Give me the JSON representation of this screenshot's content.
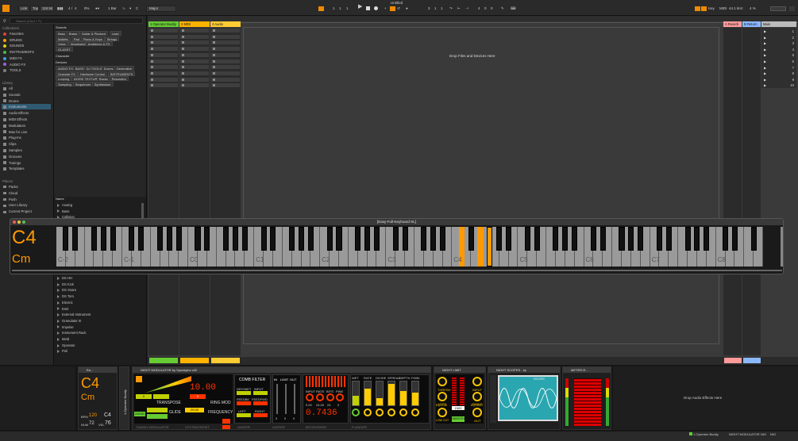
{
  "topbar": {
    "link": "Link",
    "tap": "Tap",
    "tempo": "119.94",
    "time_sig_num": "4",
    "time_sig_den": "4",
    "percent": "0%",
    "quantize": "1 Bar",
    "key": "C",
    "scale": "Major",
    "pos1": "1",
    "pos2": "1",
    "pos3": "1",
    "loop1": "3",
    "loop2": "1",
    "loop3": "1",
    "len1": "4",
    "len2": "0",
    "len3": "0",
    "window_title": "Untitled",
    "key_label": "Key",
    "midi_label": "MIDI",
    "sample_rate": "44.1 kHz",
    "cpu": "4 %"
  },
  "browser": {
    "search_placeholder": "Search (Cmd + F)",
    "collections_head": "Collections",
    "collections": [
      {
        "label": "Favorites",
        "color": "#e04040"
      },
      {
        "label": "DRUMS",
        "color": "#f0a000"
      },
      {
        "label": "SOUNDS",
        "color": "#e0d000"
      },
      {
        "label": "INSTRUMENTS",
        "color": "#40c040"
      },
      {
        "label": "MIDI FX",
        "color": "#40a0e0"
      },
      {
        "label": "AUDIO FX",
        "color": "#a060e0"
      },
      {
        "label": "TOOLS",
        "color": "#808080"
      }
    ],
    "library_head": "Library",
    "library": [
      "All",
      "Sounds",
      "Drums",
      "Instruments",
      "Audio Effects",
      "MIDI Effects",
      "Modulators",
      "Max for Live",
      "Plug-Ins",
      "Clips",
      "Samples",
      "Grooves",
      "Tunings",
      "Templates"
    ],
    "places_head": "Places",
    "places": [
      "Packs",
      "Cloud",
      "Push",
      "User Library",
      "Current Project"
    ],
    "sounds_label": "Sounds",
    "sound_tags": [
      [
        "Bass",
        "Brass",
        "Guitar & Plucked",
        "Lead"
      ],
      [
        "Mallets",
        "Pad",
        "Piano & Keys",
        "Strings"
      ],
      [
        "Voice",
        "Woodwind",
        "Ambience & FX"
      ],
      [
        "GLASST"
      ]
    ],
    "character_label": "Character",
    "devices_label": "Devices",
    "device_tags": [
      [
        "AUDIO FX",
        "BASS",
        "DJ TOOLS",
        "Drums",
        "Generative"
      ],
      [
        "Granular FX",
        "Hardware Control",
        "INSTRUMENTS"
      ],
      [
        "Looping",
        "NOISE TEXTURE",
        "Racks",
        "Resonator"
      ],
      [
        "Sampling",
        "Sequencer",
        "Synthesizer"
      ]
    ],
    "name_head": "Name",
    "names_top": [
      "Analog",
      "Bass",
      "Collision"
    ],
    "names_bottom": [
      "DS HH",
      "DS Kick",
      "DS Snare",
      "DS Tom",
      "Electric",
      "Emit",
      "External Instrument",
      "Granulator III",
      "Impulse",
      "Instrument Rack",
      "Meld",
      "Operator",
      "Poli"
    ]
  },
  "session": {
    "tracks": [
      {
        "label": "1 Operator Buddy",
        "color": "#66cc33"
      },
      {
        "label": "2 MIDI",
        "color": "#ffb300"
      },
      {
        "label": "3 Audio",
        "color": "#ffcc33"
      }
    ],
    "drop_text": "Drop Files and Devices Here",
    "returns": [
      {
        "label": "A Reverb",
        "color": "#ff9a9a"
      },
      {
        "label": "B Return",
        "color": "#8ab8ff"
      }
    ],
    "main_label": "Main",
    "scene_numbers": [
      "1",
      "2",
      "3",
      "4",
      "5",
      "6",
      "7",
      "8",
      "9",
      "10"
    ]
  },
  "keyboard": {
    "title": "[Easy-Full-Keyboard-XL]",
    "note": "C4",
    "chord": "Cm",
    "octave_labels": [
      "C-2",
      "C-1",
      "C0",
      "C1",
      "C2",
      "C3",
      "C4",
      "C5",
      "C6",
      "C7",
      "C8"
    ],
    "highlight_color": "#ff9900"
  },
  "devices": {
    "dev1_title": "Ea...",
    "dev1_note": "C4",
    "dev1_chord": "Cm",
    "dev1_bpm_label": "BPM",
    "dev1_bpm": "120",
    "dev1_num_label": "NUM",
    "dev1_num": "72",
    "dev1_vel_label": "VEL",
    "dev1_vel": "76",
    "dev1_note2": "C4",
    "rack_label": "1-Operator Buddy",
    "night_mod_title": "NIGHT MODULATOR by Spookyinc v02",
    "transpose_label": "TRANSPOSE",
    "ring_mod_label": "RING MOD",
    "ring_value": "10.00",
    "glide_label": "GLIDE",
    "frequency_label": "FREQUENCY",
    "freq_value": "20.00",
    "good_label": "GOOD",
    "zero": "0",
    "comb_filter": "COMB FILTER",
    "dry_wet": "DRY/WET",
    "input": "INPUT",
    "feedbk": "FEEDBK",
    "feedfwd": "FEEDFWD",
    "left": "LEFT",
    "right": "RIGHT",
    "in_label": "IN",
    "limit_label": "LIMIT",
    "out_label": "OUT",
    "bitcrusher_val": "0.7436",
    "flanger_labels": [
      "WET",
      "RATE",
      "DIVIDE",
      "SPREAD",
      "DEPTH",
      "FDBK"
    ],
    "input_label": "INPUT",
    "rate_label": "RATE",
    "bits_label": "BITS",
    "fine_label": "FINE",
    "crush_vals": [
      "0.00",
      "24.00",
      "24",
      "0"
    ],
    "tuning_modulator": "TUNING MODULATOR",
    "system_reset": "SYSTEM RESET",
    "limiter": "LIMITER",
    "bitcrusher": "BITCRUSHER",
    "flanger": "FLANGER",
    "night_limit_title": "NIGHT LIMIT",
    "thresh": "THRESH",
    "eq_low": "EQ LOW",
    "eq_high": "EQ HIGH",
    "low_cut": "LOW CUT",
    "smooth": "SMOOTH",
    "out": "OUT",
    "limit_val": "1500",
    "night_scopes_title": "NIGHT SCOPES - by",
    "scope_mode": "SCOPE",
    "meter_title": "METER-R...",
    "drop_effects": "Drop Audio Effects Here",
    "bottom_track": "1-Operator Buddy",
    "bottom_chain": "NIGHT MODULATOR",
    "bottom_chain2": "NIG",
    "bottom_chain3": "NIG"
  }
}
